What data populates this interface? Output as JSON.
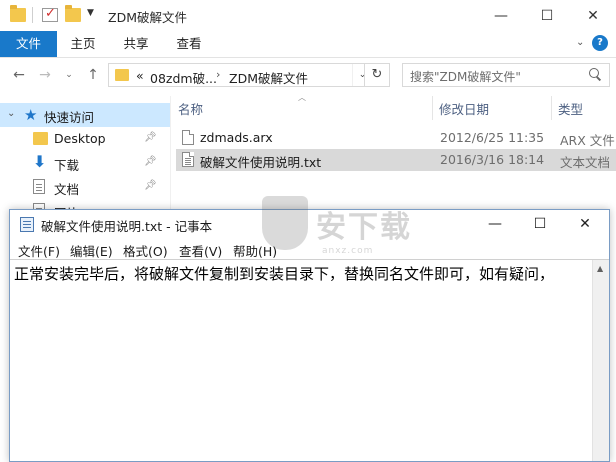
{
  "explorer": {
    "title": "ZDM破解文件",
    "ribbon_tabs": [
      "文件",
      "主页",
      "共享",
      "查看"
    ],
    "help": "?",
    "address": {
      "overflow": "«",
      "segments": [
        "08zdm破...",
        "ZDM破解文件"
      ]
    },
    "search_placeholder": "搜索\"ZDM破解文件\"",
    "sidebar": {
      "quick_access": "快速访问",
      "items": [
        "Desktop",
        "下载",
        "文档",
        "图片"
      ]
    },
    "columns": [
      "名称",
      "修改日期",
      "类型"
    ],
    "files": [
      {
        "name": "zdmads.arx",
        "date": "2012/6/25 11:35",
        "type": "ARX 文件"
      },
      {
        "name": "破解文件使用说明.txt",
        "date": "2016/3/16 18:14",
        "type": "文本文档"
      }
    ]
  },
  "notepad": {
    "title": "破解文件使用说明.txt - 记事本",
    "menu": [
      "文件(F)",
      "编辑(E)",
      "格式(O)",
      "查看(V)",
      "帮助(H)"
    ],
    "content": "正常安装完毕后，将破解文件复制到安装目录下，替换同名文件即可，如有疑问，"
  },
  "watermark": {
    "text": "安下载",
    "sub": "anxz.com"
  }
}
